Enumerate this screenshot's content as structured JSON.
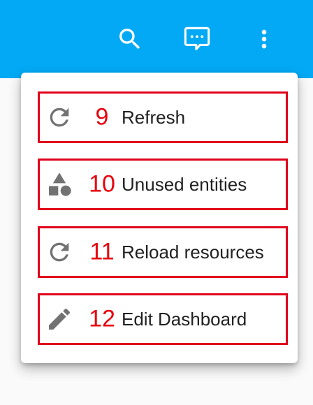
{
  "colors": {
    "app_bar": "#03a9f4",
    "menu_background": "#ffffff",
    "annotation_red": "#e0001a",
    "icon_grey": "#727272",
    "label_text": "#212121"
  },
  "toolbar": {
    "icons": [
      "search-icon",
      "message-dots-icon",
      "dots-vertical-icon"
    ]
  },
  "menu": {
    "items": [
      {
        "badge": "9",
        "label": "Refresh",
        "icon": "refresh-icon"
      },
      {
        "badge": "10",
        "label": "Unused entities",
        "icon": "shapes-icon"
      },
      {
        "badge": "11",
        "label": "Reload resources",
        "icon": "refresh-icon"
      },
      {
        "badge": "12",
        "label": "Edit Dashboard",
        "icon": "pencil-icon"
      }
    ]
  }
}
